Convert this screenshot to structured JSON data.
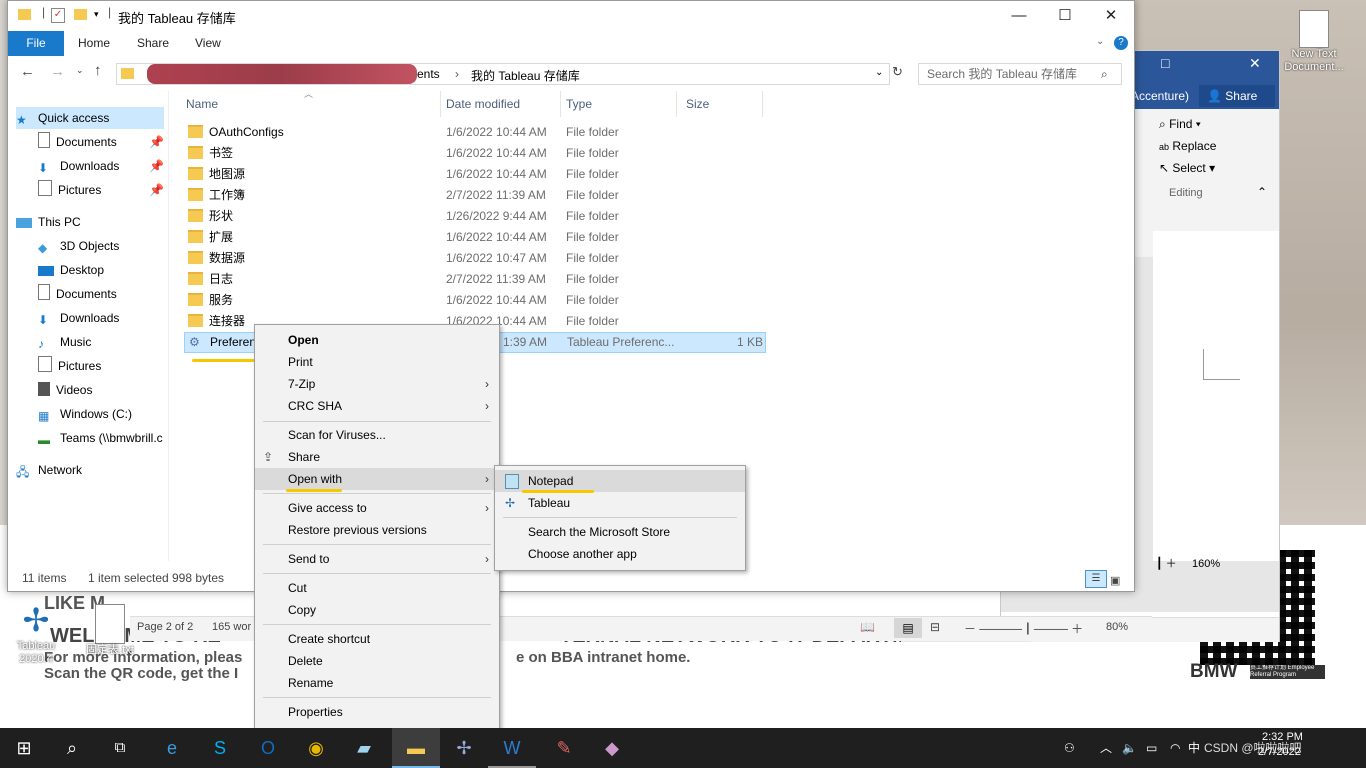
{
  "explorer": {
    "title": "我的 Tableau 存储库",
    "tabs": {
      "file": "File",
      "home": "Home",
      "share": "Share",
      "view": "View"
    },
    "address": {
      "segment1": "ents",
      "current": "我的 Tableau 存储库"
    },
    "search_placeholder": "Search 我的 Tableau 存储库",
    "columns": {
      "name": "Name",
      "date": "Date modified",
      "type": "Type",
      "size": "Size"
    },
    "files": [
      {
        "name": "OAuthConfigs",
        "date": "1/6/2022 10:44 AM",
        "type": "File folder",
        "size": ""
      },
      {
        "name": "书签",
        "date": "1/6/2022 10:44 AM",
        "type": "File folder",
        "size": ""
      },
      {
        "name": "地图源",
        "date": "1/6/2022 10:44 AM",
        "type": "File folder",
        "size": ""
      },
      {
        "name": "工作簿",
        "date": "2/7/2022 11:39 AM",
        "type": "File folder",
        "size": ""
      },
      {
        "name": "形状",
        "date": "1/26/2022 9:44 AM",
        "type": "File folder",
        "size": ""
      },
      {
        "name": "扩展",
        "date": "1/6/2022 10:44 AM",
        "type": "File folder",
        "size": ""
      },
      {
        "name": "数据源",
        "date": "1/6/2022 10:47 AM",
        "type": "File folder",
        "size": ""
      },
      {
        "name": "日志",
        "date": "2/7/2022 11:39 AM",
        "type": "File folder",
        "size": ""
      },
      {
        "name": "服务",
        "date": "1/6/2022 10:44 AM",
        "type": "File folder",
        "size": ""
      },
      {
        "name": "连接器",
        "date": "1/6/2022 10:44 AM",
        "type": "File folder",
        "size": ""
      },
      {
        "name": "Preferenc",
        "date": "1:39 AM",
        "type": "Tableau Preferenc...",
        "size": "1 KB"
      }
    ],
    "nav": {
      "quick_access": "Quick access",
      "qa_documents": "Documents",
      "qa_downloads": "Downloads",
      "qa_pictures": "Pictures",
      "this_pc": "This PC",
      "objects3d": "3D Objects",
      "desktop": "Desktop",
      "documents": "Documents",
      "downloads": "Downloads",
      "music": "Music",
      "pictures": "Pictures",
      "videos": "Videos",
      "windows_c": "Windows (C:)",
      "teams": "Teams (\\\\bmwbrill.c",
      "network": "Network"
    },
    "status": {
      "items": "11 items",
      "selected": "1 item selected",
      "size": "998 bytes"
    }
  },
  "context_menu": {
    "open": "Open",
    "print": "Print",
    "zip": "7-Zip",
    "crc": "CRC SHA",
    "scan": "Scan for Viruses...",
    "share": "Share",
    "open_with": "Open with",
    "give_access": "Give access to",
    "restore": "Restore previous versions",
    "send_to": "Send to",
    "cut": "Cut",
    "copy": "Copy",
    "create_shortcut": "Create shortcut",
    "delete": "Delete",
    "rename": "Rename",
    "properties": "Properties"
  },
  "submenu": {
    "notepad": "Notepad",
    "tableau": "Tableau",
    "store": "Search the Microsoft Store",
    "another": "Choose another app"
  },
  "word": {
    "accenture": "Accenture)",
    "share": "Share",
    "find": "Find",
    "replace": "Replace",
    "select": "Select",
    "editing": "Editing",
    "zoom_small": "160%",
    "page": "Page 2 of 2",
    "words": "165 wor",
    "zoom": "80%"
  },
  "desktop": {
    "new_text": "New Text Document...",
    "tableau_icon": "Tableau 2020.4",
    "fixed_icon": "固定表.txt",
    "banner1": "LIKE M",
    "banner2": "WELCOME TO RE",
    "banner2b": "TERNAL NETWORK TO IT DEPARTMENT!",
    "banner3": "For more information, pleas",
    "banner3b": "e on BBA intranet home.",
    "banner4": "Scan the QR code, get the I",
    "bmw": "BMW",
    "bmw_sub": "员工推荐计划 Employee Referral Program"
  },
  "taskbar": {
    "time": "2:32 PM",
    "date": "2/7/2022",
    "watermark": "CSDN @啦啦啦吧",
    "ime": "中"
  }
}
